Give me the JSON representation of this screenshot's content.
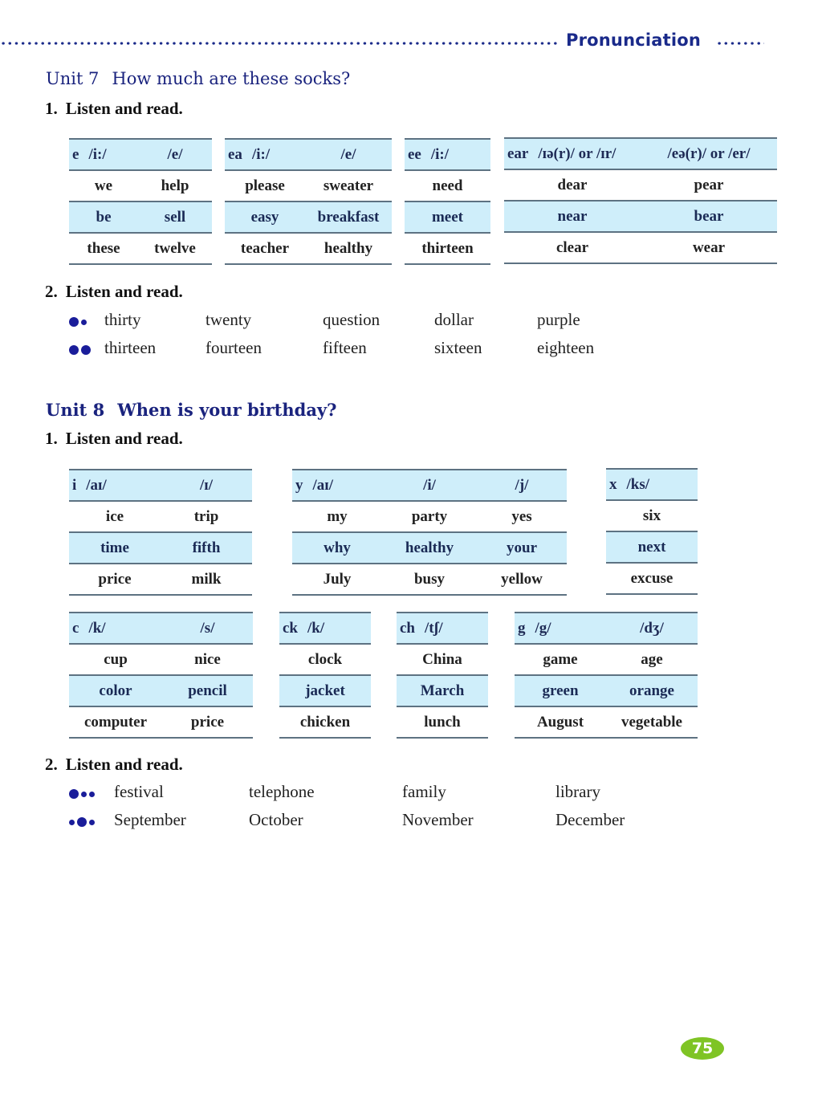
{
  "header": {
    "title": "Pronunciation"
  },
  "unit7": {
    "number": "Unit 7",
    "title": "How much are these socks?",
    "section1_index": "1.",
    "section1_label": "Listen and read.",
    "tables": [
      {
        "letter": "e",
        "sounds": [
          "/i:/",
          "/e/"
        ],
        "rows": [
          [
            "we",
            "help"
          ],
          [
            "be",
            "sell"
          ],
          [
            "these",
            "twelve"
          ]
        ]
      },
      {
        "letter": "ea",
        "sounds": [
          "/i:/",
          "/e/"
        ],
        "rows": [
          [
            "please",
            "sweater"
          ],
          [
            "easy",
            "breakfast"
          ],
          [
            "teacher",
            "healthy"
          ]
        ]
      },
      {
        "letter": "ee",
        "sounds": [
          "/i:/"
        ],
        "rows": [
          [
            "need"
          ],
          [
            "meet"
          ],
          [
            "thirteen"
          ]
        ]
      },
      {
        "letter": "ear",
        "sounds": [
          "/ɪə(r)/ or /ɪr/",
          "/eə(r)/ or /er/"
        ],
        "rows": [
          [
            "dear",
            "pear"
          ],
          [
            "near",
            "bear"
          ],
          [
            "clear",
            "wear"
          ]
        ]
      }
    ],
    "section2_index": "2.",
    "section2_label": "Listen and read.",
    "stress_rows": [
      {
        "pattern": "big-small",
        "words": [
          "thirty",
          "twenty",
          "question",
          "dollar",
          "purple"
        ]
      },
      {
        "pattern": "big-big",
        "words": [
          "thirteen",
          "fourteen",
          "fifteen",
          "sixteen",
          "eighteen"
        ]
      }
    ]
  },
  "unit8": {
    "number": "Unit 8",
    "title": "When is your birthday?",
    "section1_index": "1.",
    "section1_label": "Listen and read.",
    "tables": [
      {
        "letter": "i",
        "sounds": [
          "/aɪ/",
          "/ɪ/"
        ],
        "rows": [
          [
            "ice",
            "trip"
          ],
          [
            "time",
            "fifth"
          ],
          [
            "price",
            "milk"
          ]
        ]
      },
      {
        "letter": "y",
        "sounds": [
          "/aɪ/",
          "/i/",
          "/j/"
        ],
        "rows": [
          [
            "my",
            "party",
            "yes"
          ],
          [
            "why",
            "healthy",
            "your"
          ],
          [
            "July",
            "busy",
            "yellow"
          ]
        ]
      },
      {
        "letter": "x",
        "sounds": [
          "/ks/"
        ],
        "rows": [
          [
            "six"
          ],
          [
            "next"
          ],
          [
            "excuse"
          ]
        ]
      },
      {
        "letter": "c",
        "sounds": [
          "/k/",
          "/s/"
        ],
        "rows": [
          [
            "cup",
            "nice"
          ],
          [
            "color",
            "pencil"
          ],
          [
            "computer",
            "price"
          ]
        ]
      },
      {
        "letter": "ck",
        "sounds": [
          "/k/"
        ],
        "rows": [
          [
            "clock"
          ],
          [
            "jacket"
          ],
          [
            "chicken"
          ]
        ]
      },
      {
        "letter": "ch",
        "sounds": [
          "/tʃ/"
        ],
        "rows": [
          [
            "China"
          ],
          [
            "March"
          ],
          [
            "lunch"
          ]
        ]
      },
      {
        "letter": "g",
        "sounds": [
          "/g/",
          "/dʒ/"
        ],
        "rows": [
          [
            "game",
            "age"
          ],
          [
            "green",
            "orange"
          ],
          [
            "August",
            "vegetable"
          ]
        ]
      }
    ],
    "section2_index": "2.",
    "section2_label": "Listen and read.",
    "stress_rows": [
      {
        "pattern": "big-small-small",
        "words": [
          "festival",
          "telephone",
          "family",
          "library"
        ]
      },
      {
        "pattern": "small-big-small",
        "words": [
          "September",
          "October",
          "November",
          "December"
        ]
      }
    ]
  },
  "page_number": "75",
  "colors": {
    "accent_blue": "#1a237e",
    "table_fill": "#cfeefa",
    "page_badge": "#7fc425"
  }
}
